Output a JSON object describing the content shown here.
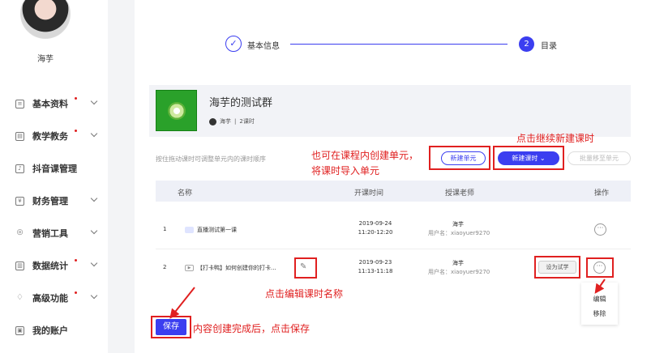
{
  "sidebar": {
    "user_name": "海芋",
    "items": [
      {
        "label": "基本资料",
        "dot": true,
        "chevron": true
      },
      {
        "label": "教学教务",
        "dot": true,
        "chevron": true
      },
      {
        "label": "抖音课管理",
        "dot": false,
        "chevron": false
      },
      {
        "label": "财务管理",
        "dot": false,
        "chevron": true
      },
      {
        "label": "营销工具",
        "dot": false,
        "chevron": true
      },
      {
        "label": "数据统计",
        "dot": true,
        "chevron": true
      },
      {
        "label": "高级功能",
        "dot": true,
        "chevron": true
      },
      {
        "label": "我的账户",
        "dot": false,
        "chevron": false
      }
    ]
  },
  "steps": {
    "step1_label": "基本信息",
    "step2_number": "2",
    "step2_label": "目录"
  },
  "course": {
    "title": "海芋的测试群",
    "teacher": "海芋",
    "separator": "|",
    "lessons": "2课时"
  },
  "toolbar": {
    "drag_hint": "按住拖动课时可调整单元内的课时顺序",
    "new_unit_label": "新建单元",
    "new_lesson_label": "新建课时",
    "batch_move_label": "批量移至单元"
  },
  "table": {
    "headers": [
      "名称",
      "开课时间",
      "授课老师",
      "操作"
    ],
    "rows": [
      {
        "index": "1",
        "name": "直播测试第一课",
        "date": "2019-09-24",
        "time": "11:20-12:20",
        "teacher": "海芋",
        "username": "用户名：xiaoyuer9270"
      },
      {
        "index": "2",
        "name": "【打卡鸭】如何创建你的打卡...",
        "date": "2019-09-23",
        "time": "11:13-11:18",
        "teacher": "海芋",
        "username": "用户名：xiaoyuer9270"
      }
    ],
    "trial_label": "设为试学",
    "more_glyph": "···",
    "video_glyph": "▶"
  },
  "dropdown": {
    "edit_label": "编辑",
    "remove_label": "移除"
  },
  "annotations": {
    "create_unit_line1": "也可在课程内创建单元，",
    "create_unit_line2": "将课时导入单元",
    "new_lesson": "点击继续新建课时",
    "edit_name": "点击编辑课时名称",
    "save": "内容创建完成后，点击保存"
  },
  "save_label": "保存",
  "colors": {
    "accent": "#3b3ef0",
    "annotation": "#e02020"
  }
}
